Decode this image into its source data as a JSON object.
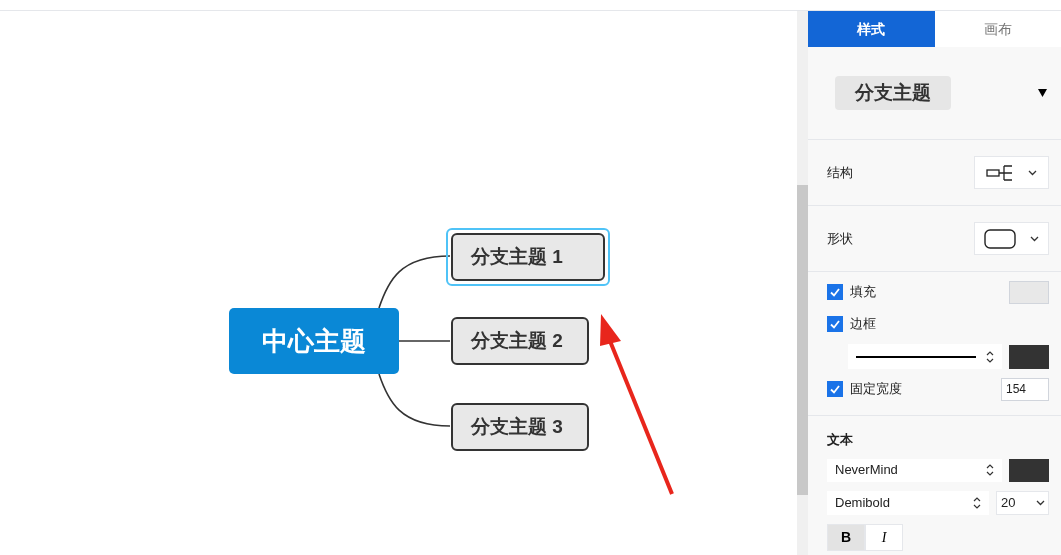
{
  "tabs": [
    {
      "label": "样式",
      "selected": true
    },
    {
      "label": "画布",
      "selected": false
    }
  ],
  "mind_map": {
    "central_topic": "中心主题",
    "branches": [
      {
        "label": "分支主题 1",
        "selected": true
      },
      {
        "label": "分支主题 2",
        "selected": false
      },
      {
        "label": "分支主题 3",
        "selected": false
      }
    ]
  },
  "style_panel": {
    "topic_style": "分支主题",
    "structure_label": "结构",
    "shape_label": "形状",
    "options": [
      {
        "kind": "fill",
        "label": "填充",
        "checked": true
      },
      {
        "kind": "border",
        "label": "边框",
        "checked": true
      },
      {
        "kind": "width",
        "label": "固定宽度",
        "checked": true,
        "value": "154"
      }
    ],
    "text": {
      "heading": "文本",
      "font": "NeverMind",
      "weight": "Demibold",
      "size": "20",
      "format_buttons": [
        {
          "label": "B",
          "selected": true
        },
        {
          "label": "I",
          "selected": false
        }
      ]
    }
  }
}
